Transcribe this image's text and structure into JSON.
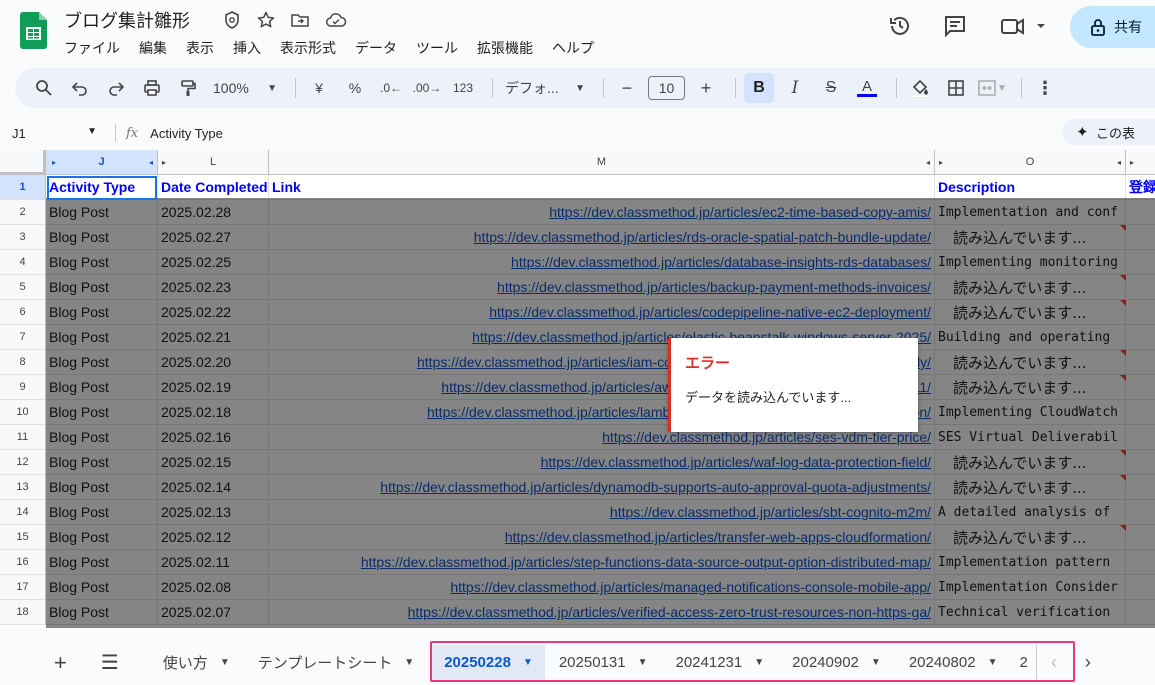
{
  "app": {
    "title": "ブログ集計雛形",
    "menu": [
      "ファイル",
      "編集",
      "表示",
      "挿入",
      "表示形式",
      "データ",
      "ツール",
      "拡張機能",
      "ヘルプ"
    ],
    "share_label": "共有"
  },
  "toolbar": {
    "zoom": "100%",
    "currency": "¥",
    "percent": "%",
    "dec_decrease": ".0",
    "dec_increase": ".00",
    "number_format": "123",
    "font": "デフォ...",
    "font_size": "10",
    "bold": "B",
    "italic": "I",
    "strike": "S",
    "text_color": "A"
  },
  "formula_bar": {
    "cell_ref": "J1",
    "fx": "fx",
    "content": "Activity Type",
    "ai_label": "この表"
  },
  "columns": [
    "J",
    "L",
    "M",
    "O"
  ],
  "rows": [
    "1",
    "2",
    "3",
    "4",
    "5",
    "6",
    "7",
    "8",
    "9",
    "10",
    "11",
    "12",
    "13",
    "14",
    "15",
    "16",
    "17",
    "18"
  ],
  "header_row": {
    "J": "Activity Type",
    "L": "Date Completed",
    "M": "Link",
    "O": "Description",
    "P": "登録"
  },
  "data_rows": [
    {
      "type": "Blog Post",
      "date": "2025.02.28",
      "link": "https://dev.classmethod.jp/articles/ec2-time-based-copy-amis/",
      "desc": "Implementation and conf"
    },
    {
      "type": "Blog Post",
      "date": "2025.02.27",
      "link": "https://dev.classmethod.jp/articles/rds-oracle-spatial-patch-bundle-update/",
      "desc": "読み込んでいます..."
    },
    {
      "type": "Blog Post",
      "date": "2025.02.25",
      "link": "https://dev.classmethod.jp/articles/database-insights-rds-databases/",
      "desc": "Implementing monitoring"
    },
    {
      "type": "Blog Post",
      "date": "2025.02.23",
      "link": "https://dev.classmethod.jp/articles/backup-payment-methods-invoices/",
      "desc": "読み込んでいます..."
    },
    {
      "type": "Blog Post",
      "date": "2025.02.22",
      "link": "https://dev.classmethod.jp/articles/codepipeline-native-ec2-deployment/",
      "desc": "読み込んでいます..."
    },
    {
      "type": "Blog Post",
      "date": "2025.02.21",
      "link": "https://dev.classmethod.jp/articles/elastic-beanstalk-windows-server-2025/",
      "desc": "Building and operating"
    },
    {
      "type": "Blog Post",
      "date": "2025.02.20",
      "link": "https://dev.classmethod.jp/articles/iam-compute-roles-for-amplify-hosting-ssr-apply/",
      "desc": "読み込んでいます..."
    },
    {
      "type": "Blog Post",
      "date": "2025.02.19",
      "link": "https://dev.classmethod.jp/articles/aws-cost-allocation-new-reports-2025-02-11/",
      "desc": "読み込んでいます..."
    },
    {
      "type": "Blog Post",
      "date": "2025.02.18",
      "link": "https://dev.classmethod.jp/articles/lambda-cloudwatch-application-signals-python/",
      "desc": "Implementing CloudWatch"
    },
    {
      "type": "Blog Post",
      "date": "2025.02.16",
      "link": "https://dev.classmethod.jp/articles/ses-vdm-tier-price/",
      "desc": "SES Virtual Deliverabil"
    },
    {
      "type": "Blog Post",
      "date": "2025.02.15",
      "link": "https://dev.classmethod.jp/articles/waf-log-data-protection-field/",
      "desc": "読み込んでいます..."
    },
    {
      "type": "Blog Post",
      "date": "2025.02.14",
      "link": "https://dev.classmethod.jp/articles/dynamodb-supports-auto-approval-quota-adjustments/",
      "desc": "読み込んでいます..."
    },
    {
      "type": "Blog Post",
      "date": "2025.02.13",
      "link": "https://dev.classmethod.jp/articles/sbt-cognito-m2m/",
      "desc": "A detailed analysis of"
    },
    {
      "type": "Blog Post",
      "date": "2025.02.12",
      "link": "https://dev.classmethod.jp/articles/transfer-web-apps-cloudformation/",
      "desc": "読み込んでいます..."
    },
    {
      "type": "Blog Post",
      "date": "2025.02.11",
      "link": "https://dev.classmethod.jp/articles/step-functions-data-source-output-option-distributed-map/",
      "desc": "Implementation pattern"
    },
    {
      "type": "Blog Post",
      "date": "2025.02.08",
      "link": "https://dev.classmethod.jp/articles/managed-notifications-console-mobile-app/",
      "desc": "Implementation Consider"
    },
    {
      "type": "Blog Post",
      "date": "2025.02.07",
      "link": "https://dev.classmethod.jp/articles/verified-access-zero-trust-resources-non-https-ga/",
      "desc": "Technical verification"
    }
  ],
  "error_popup": {
    "title": "エラー",
    "message": "データを読み込んでいます..."
  },
  "sheet_tabs": [
    "使い方",
    "テンプレートシート",
    "20250228",
    "20250131",
    "20241231",
    "20240902",
    "20240802",
    "2"
  ],
  "active_tab": "20250228",
  "colors": {
    "accent": "#0b57d0",
    "error": "#d93025",
    "highlight": "#e6397a",
    "header_text": "#0000ff",
    "link": "#1155cc"
  }
}
